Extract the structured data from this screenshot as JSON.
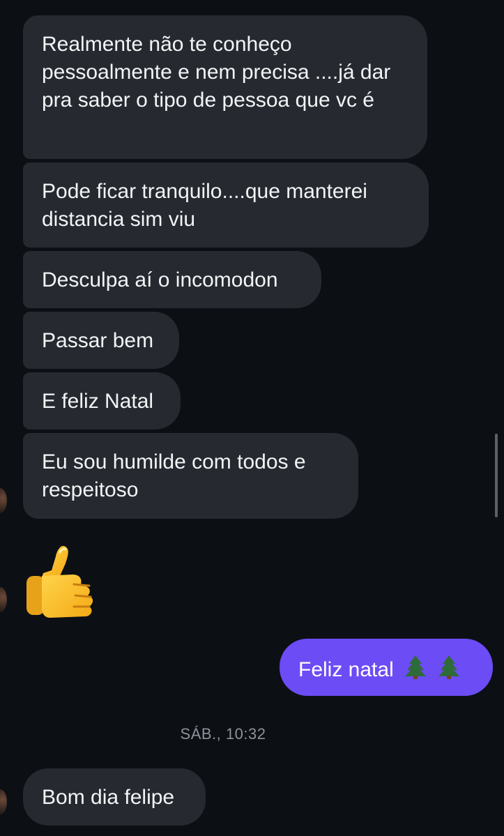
{
  "messages": [
    {
      "id": "m1",
      "text": "Realmente não te conheço pessoalmente e nem precisa ....já dar pra saber o tipo de pessoa que vc é"
    },
    {
      "id": "m2",
      "text": "Pode ficar tranquilo....que manterei distancia sim viu"
    },
    {
      "id": "m3",
      "text": "Desculpa aí o incomodon"
    },
    {
      "id": "m4",
      "text": "Passar bem"
    },
    {
      "id": "m5",
      "text": "E feliz Natal"
    },
    {
      "id": "m6",
      "text": "Eu sou humilde com todos e respeitoso"
    },
    {
      "id": "m7",
      "emoji": "thumbs-up-icon"
    },
    {
      "id": "m8",
      "text": "Feliz natal",
      "emoji_suffix": "christmas-tree-icon christmas-tree-icon"
    },
    {
      "id": "m9",
      "text": "Bom dia felipe"
    }
  ],
  "timestamp": "SÁB., 10:32",
  "colors": {
    "background": "#0c0f14",
    "incoming_bubble": "#262a30",
    "outgoing_bubble": "#6c4cf5",
    "timestamp_text": "#8e939b"
  }
}
